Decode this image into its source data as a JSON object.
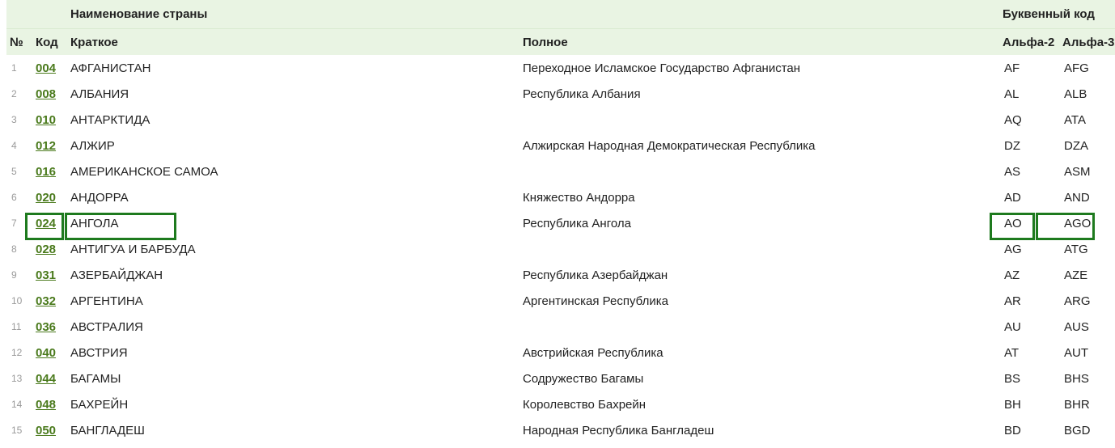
{
  "header": {
    "country_name_group": "Наименование страны",
    "letter_code_group": "Буквенный код",
    "col_number": "№",
    "col_code": "Код",
    "col_short": "Краткое",
    "col_full": "Полное",
    "col_alpha2": "Альфа-2",
    "col_alpha3": "Альфа-3"
  },
  "colors": {
    "header_bg": "#e9f4e3",
    "link": "#4a7a1c",
    "highlight": "#1e7a1e"
  },
  "rows": [
    {
      "num": "1",
      "code": "004",
      "short": "АФГАНИСТАН",
      "full": "Переходное Исламское Государство Афганистан",
      "alpha2": "AF",
      "alpha3": "AFG"
    },
    {
      "num": "2",
      "code": "008",
      "short": "АЛБАНИЯ",
      "full": "Республика Албания",
      "alpha2": "AL",
      "alpha3": "ALB"
    },
    {
      "num": "3",
      "code": "010",
      "short": "АНТАРКТИДА",
      "full": "",
      "alpha2": "AQ",
      "alpha3": "ATA"
    },
    {
      "num": "4",
      "code": "012",
      "short": "АЛЖИР",
      "full": "Алжирская Народная Демократическая Республика",
      "alpha2": "DZ",
      "alpha3": "DZA"
    },
    {
      "num": "5",
      "code": "016",
      "short": "АМЕРИКАНСКОЕ САМОА",
      "full": "",
      "alpha2": "AS",
      "alpha3": "ASM"
    },
    {
      "num": "6",
      "code": "020",
      "short": "АНДОРРА",
      "full": "Княжество Андорра",
      "alpha2": "AD",
      "alpha3": "AND"
    },
    {
      "num": "7",
      "code": "024",
      "short": "АНГОЛА",
      "full": "Республика Ангола",
      "alpha2": "AO",
      "alpha3": "AGO"
    },
    {
      "num": "8",
      "code": "028",
      "short": "АНТИГУА И БАРБУДА",
      "full": "",
      "alpha2": "AG",
      "alpha3": "ATG"
    },
    {
      "num": "9",
      "code": "031",
      "short": "АЗЕРБАЙДЖАН",
      "full": "Республика Азербайджан",
      "alpha2": "AZ",
      "alpha3": "AZE"
    },
    {
      "num": "10",
      "code": "032",
      "short": "АРГЕНТИНА",
      "full": "Аргентинская Республика",
      "alpha2": "AR",
      "alpha3": "ARG"
    },
    {
      "num": "11",
      "code": "036",
      "short": "АВСТРАЛИЯ",
      "full": "",
      "alpha2": "AU",
      "alpha3": "AUS"
    },
    {
      "num": "12",
      "code": "040",
      "short": "АВСТРИЯ",
      "full": "Австрийская Республика",
      "alpha2": "AT",
      "alpha3": "AUT"
    },
    {
      "num": "13",
      "code": "044",
      "short": "БАГАМЫ",
      "full": "Содружество Багамы",
      "alpha2": "BS",
      "alpha3": "BHS"
    },
    {
      "num": "14",
      "code": "048",
      "short": "БАХРЕЙН",
      "full": "Королевство Бахрейн",
      "alpha2": "BH",
      "alpha3": "BHR"
    },
    {
      "num": "15",
      "code": "050",
      "short": "БАНГЛАДЕШ",
      "full": "Народная Республика Бангладеш",
      "alpha2": "BD",
      "alpha3": "BGD"
    }
  ]
}
